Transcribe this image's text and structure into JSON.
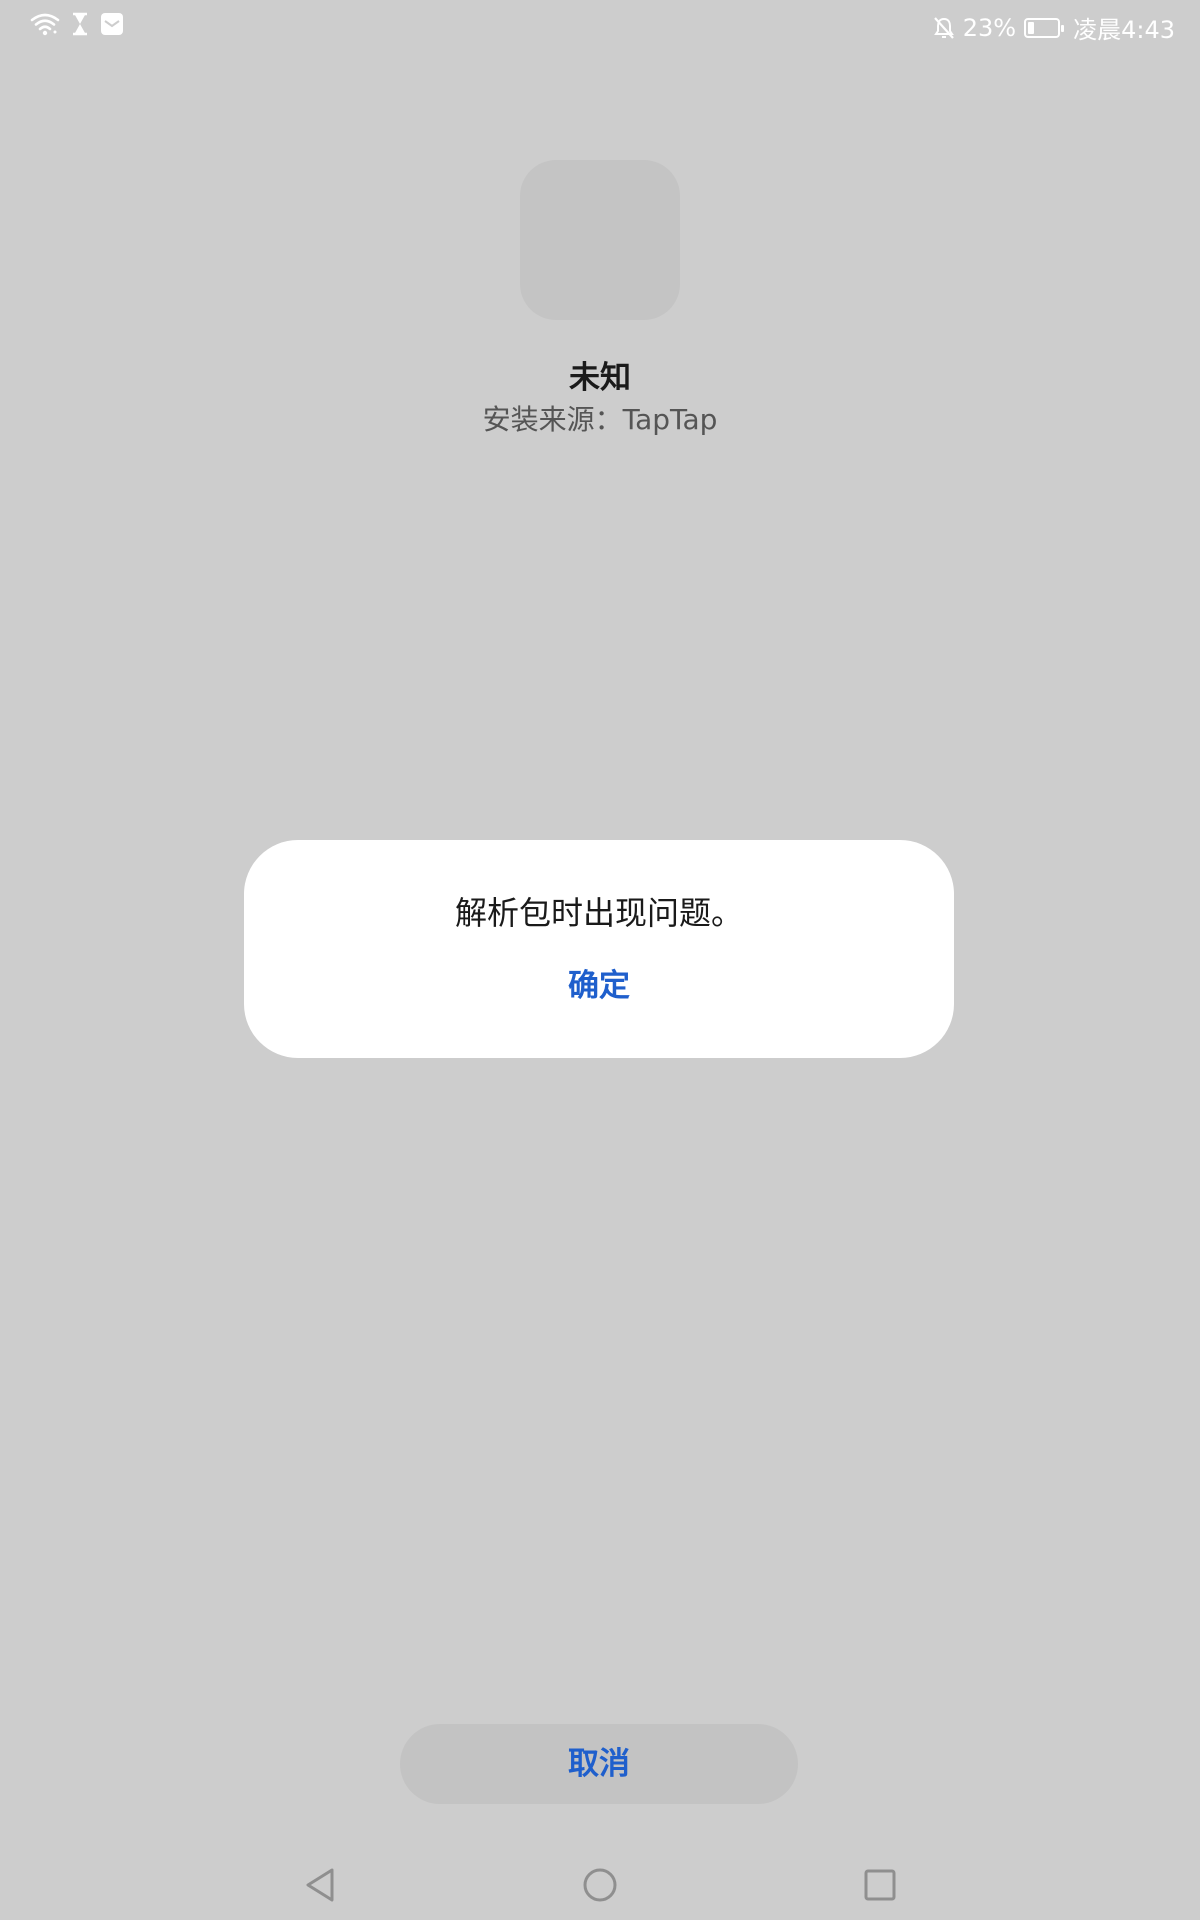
{
  "status_bar": {
    "battery_percent_text": "23%",
    "battery_level": 0.23,
    "time": "凌晨4:43",
    "icons": [
      "wifi-icon",
      "hourglass-icon",
      "mail-icon",
      "bell-off-icon",
      "battery-icon"
    ]
  },
  "app": {
    "name": "未知",
    "install_source": "安装来源：TapTap"
  },
  "dialog": {
    "message": "解析包时出现问题。",
    "confirm_label": "确定"
  },
  "footer": {
    "cancel_label": "取消"
  },
  "nav_bar": {
    "icons": [
      "back-icon",
      "home-icon",
      "recents-icon"
    ]
  },
  "colors": {
    "background": "#cdcdcd",
    "accent": "#1f5fcc",
    "dialog_bg": "#ffffff"
  }
}
